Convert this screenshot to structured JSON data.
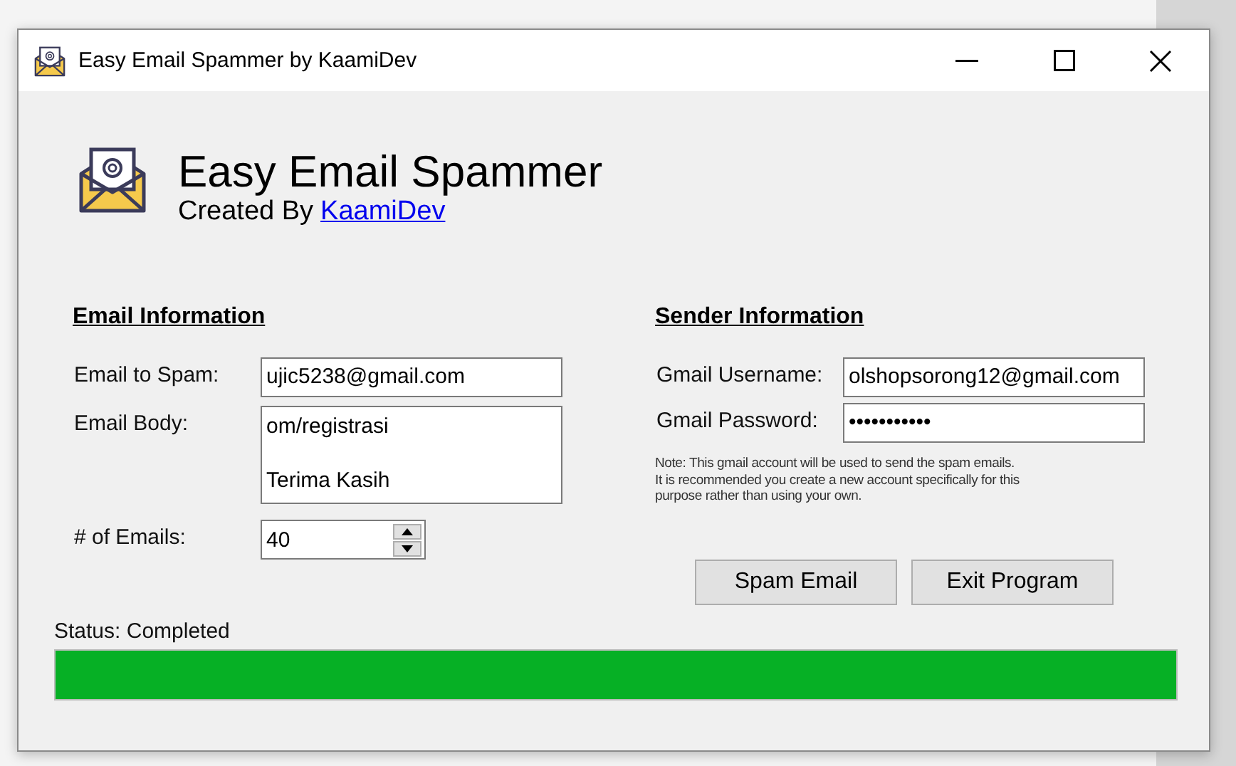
{
  "window": {
    "title": "Easy Email Spammer by KaamiDev"
  },
  "header": {
    "title": "Easy Email Spammer",
    "credit_prefix": "Created By",
    "credit_link": "KaamiDev"
  },
  "email_information": {
    "heading": "Email Information",
    "fields": [
      {
        "kind": "text",
        "label": "Email to Spam:",
        "value": "ujic5238@gmail.com"
      },
      {
        "kind": "multiline",
        "label": "Email Body:",
        "lines": [
          "om/registrasi",
          "Terima Kasih"
        ]
      },
      {
        "kind": "spinner",
        "label": "# of Emails:",
        "value": "40"
      }
    ]
  },
  "sender_information": {
    "heading": "Sender Information",
    "fields": [
      {
        "kind": "text",
        "label": "Gmail Username:",
        "value": "olshopsorong12@gmail.com"
      },
      {
        "kind": "text",
        "label": "Gmail Password:",
        "value": "•••••••••••"
      }
    ],
    "note": [
      "Note: This gmail account will be used to send the spam emails.",
      "It is recommended you create a new account specifically for this",
      "purpose rather than using your own."
    ]
  },
  "buttons": [
    "Spam Email",
    "Exit Program"
  ],
  "status": {
    "label": "Status: Completed",
    "level": 1
  }
}
